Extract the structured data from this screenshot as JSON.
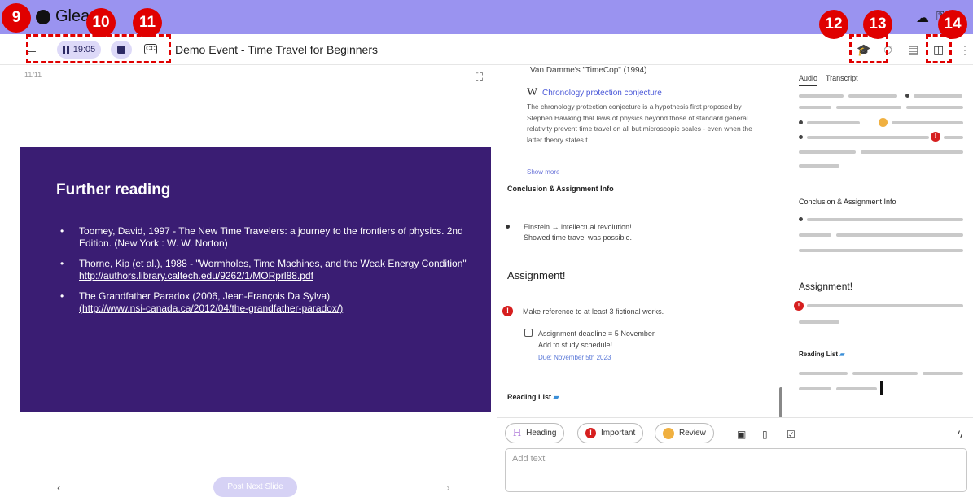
{
  "app": {
    "name": "Glean"
  },
  "toolbar": {
    "timer": "19:05",
    "cc_label": "CC",
    "title": "Demo Event - Time Travel for Beginners"
  },
  "annotations": [
    "9",
    "10",
    "11",
    "12",
    "13",
    "14"
  ],
  "slide": {
    "counter": "11/11",
    "heading": "Further reading",
    "items": [
      {
        "text": "Toomey, David, 1997 - The New Time Travelers: a journey to the frontiers of physics. 2nd Edition. (New York : W. W. Norton)",
        "link": ""
      },
      {
        "text": "Thorne, Kip (et al.), 1988 - \"Wormholes, Time Machines, and the Weak Energy Condition\"",
        "link": "http://authors.library.caltech.edu/9262/1/MORprl88.pdf"
      },
      {
        "text": "The Grandfather Paradox (2006, Jean-François Da Sylva)",
        "link": "(http://www.nsi-canada.ca/2012/04/the-grandfather-paradox/)"
      }
    ],
    "post_next": "Post Next Slide"
  },
  "notes": {
    "source_line": "Van Damme's \"TimeCop\" (1994)",
    "wiki_title": "Chronology protection conjecture",
    "wiki_body": "The chronology protection conjecture is a hypothesis first proposed by Stephen Hawking that laws of physics beyond those of standard general relativity prevent time travel on all but microscopic scales - even when the latter theory states t...",
    "show_more": "Show more",
    "conclusion_heading": "Conclusion & Assignment Info",
    "einstein_line1": "Einstein → intellectual revolution!",
    "einstein_line2": "Showed time travel was possible.",
    "assignment_heading": "Assignment!",
    "important_text": "Make reference to at least 3 fictional works.",
    "task_line1": "Assignment deadline = 5 November",
    "task_line2": "Add to study schedule!",
    "due": "Due: November 5th 2023",
    "reading_heading": "Reading List"
  },
  "editor": {
    "heading_chip": "Heading",
    "important_chip": "Important",
    "review_chip": "Review",
    "placeholder": "Add text"
  },
  "minimap": {
    "tab_audio": "Audio",
    "tab_transcript": "Transcript",
    "conclusion_heading": "Conclusion & Assignment Info",
    "assignment_heading": "Assignment!",
    "reading_heading": "Reading List"
  },
  "colors": {
    "topbar": "#9a93f0",
    "slide_bg": "#3a1d73",
    "annotation_red": "#e00000",
    "important_red": "#d61f1f",
    "link_blue": "#4a58d8"
  }
}
